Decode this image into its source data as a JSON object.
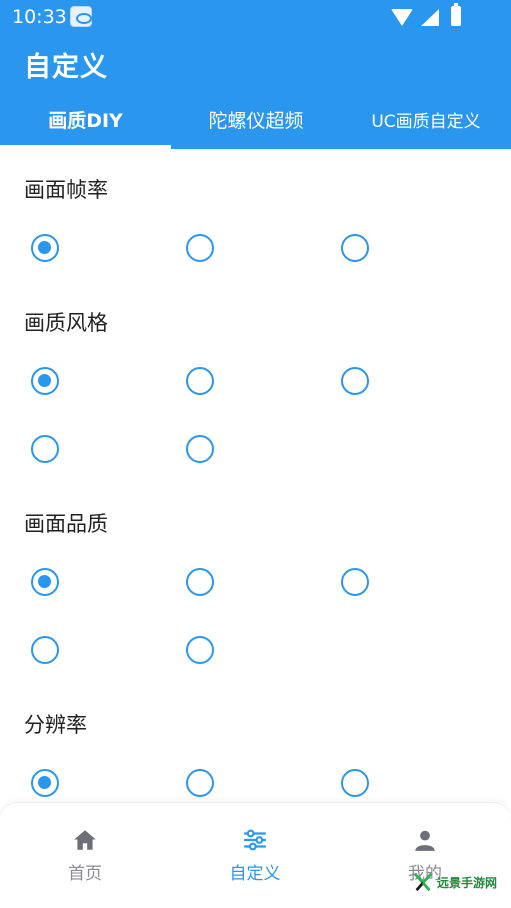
{
  "status_bar": {
    "time": "10:33",
    "icons": [
      "app-notification-icon",
      "wifi-icon",
      "cell-signal-icon",
      "battery-charging-icon"
    ]
  },
  "header": {
    "title": "自定义",
    "background_color": "#2b96ee",
    "tabs": [
      {
        "label": "画质DIY",
        "selected": true
      },
      {
        "label": "陀螺仪超频",
        "selected": false
      },
      {
        "label": "UC画质自定义",
        "selected": false
      }
    ]
  },
  "sections": [
    {
      "title": "画面帧率",
      "options": 3,
      "selected_index": 0
    },
    {
      "title": "画质风格",
      "options": 5,
      "selected_index": 0
    },
    {
      "title": "画面品质",
      "options": 5,
      "selected_index": 0
    },
    {
      "title": "分辨率",
      "options": 3,
      "selected_index": 0
    }
  ],
  "bottom_nav": {
    "items": [
      {
        "label": "首页",
        "icon": "home-icon",
        "active": false
      },
      {
        "label": "自定义",
        "icon": "sliders-icon",
        "active": true
      },
      {
        "label": "我的",
        "icon": "person-icon",
        "active": false
      }
    ]
  },
  "watermark": {
    "text": "远景手游网"
  },
  "colors": {
    "accent": "#2b96ee",
    "inactive_nav": "#8a8a96",
    "section_text": "#222222"
  }
}
